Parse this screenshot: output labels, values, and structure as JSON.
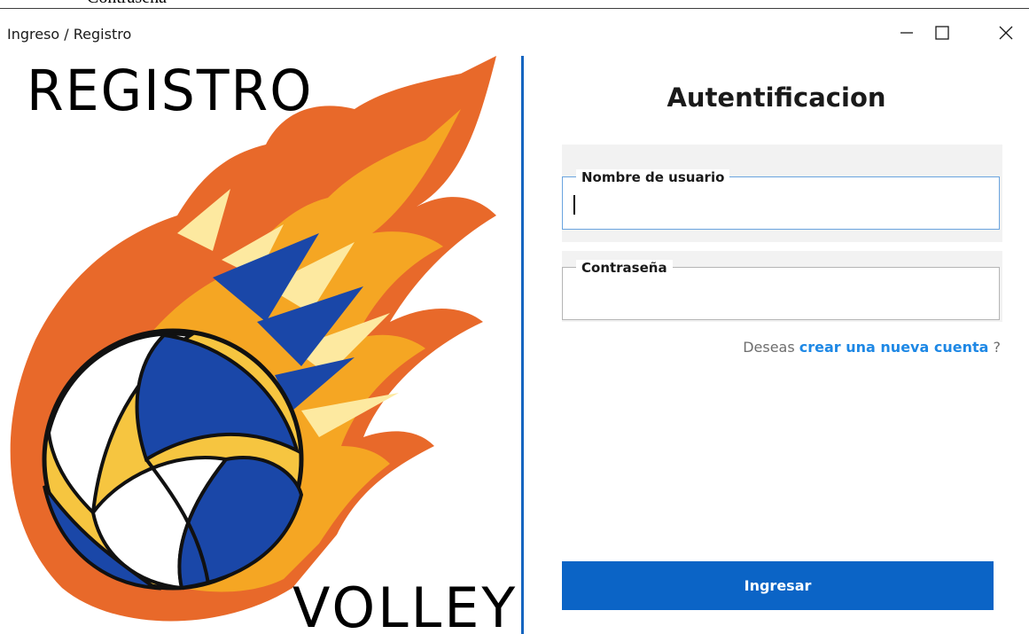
{
  "cut_off_top_text": "Contraseña",
  "window": {
    "title": "Ingreso / Registro",
    "controls": [
      "minimize-icon",
      "maximize-icon",
      "close-icon"
    ]
  },
  "logo": {
    "top_text": "REGISTRO",
    "bottom_text": "VOLLEY",
    "image": "volleyball-in-flames-icon"
  },
  "form": {
    "heading": "Autentificacion",
    "username": {
      "label": "Nombre de usuario",
      "value": "",
      "placeholder": ""
    },
    "password": {
      "label": "Contraseña",
      "value": "",
      "placeholder": ""
    },
    "signup_prefix": "Deseas",
    "signup_link": "crear una nueva cuenta",
    "signup_suffix": "?",
    "submit_label": "Ingresar"
  },
  "colors": {
    "accent": "#0b64c6",
    "link": "#1e88e5",
    "divider": "#1565c0",
    "flame_outer": "#e8692a",
    "flame_inner": "#f5a623",
    "ball_blue": "#1a47a8",
    "ball_yellow": "#f6c540"
  }
}
